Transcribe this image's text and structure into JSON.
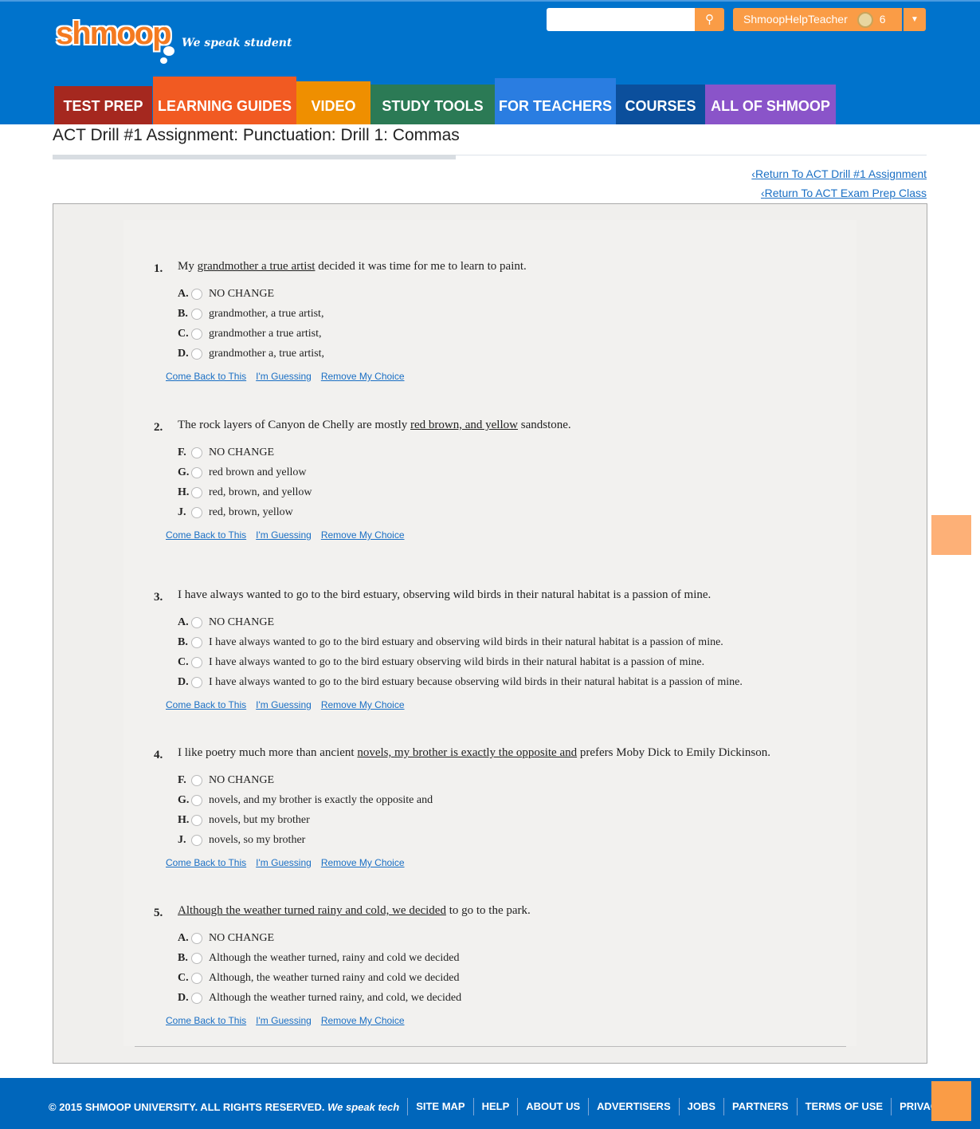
{
  "header": {
    "logo": "shmoop",
    "tagline": "We speak student",
    "search_placeholder": "",
    "search_icon": "search-icon",
    "username": "ShmoopHelpTeacher",
    "badge_count": "6",
    "dropdown_icon": "caret-down-icon"
  },
  "nav": [
    {
      "label": "TEST PREP",
      "color": "#a5281f"
    },
    {
      "label": "LEARNING GUIDES",
      "color": "#f15a22"
    },
    {
      "label": "VIDEO",
      "color": "#ef8f00"
    },
    {
      "label": "STUDY TOOLS",
      "color": "#2b7a55"
    },
    {
      "label": "FOR TEACHERS",
      "color": "#2a7de1"
    },
    {
      "label": "COURSES",
      "color": "#0b4f9c"
    },
    {
      "label": "ALL OF SHMOOP",
      "color": "#8a54c9"
    }
  ],
  "page": {
    "title": "ACT Drill #1 Assignment: Punctuation: Drill 1: Commas",
    "return_assignment": "Return To ACT Drill #1 Assignment",
    "return_class": "Return To ACT Exam Prep Class"
  },
  "actions": {
    "come_back": "Come Back to This",
    "guessing": "I'm Guessing",
    "remove": "Remove My Choice"
  },
  "questions": [
    {
      "num": "1.",
      "before": "My ",
      "underlined": "grandmother a true artist",
      "after": " decided it was time for me to learn to paint.",
      "options": [
        {
          "letter": "A.",
          "text": "NO CHANGE"
        },
        {
          "letter": "B.",
          "text": "grandmother, a true artist,"
        },
        {
          "letter": "C.",
          "text": "grandmother a true artist,"
        },
        {
          "letter": "D.",
          "text": "grandmother a, true artist,"
        }
      ]
    },
    {
      "num": "2.",
      "before": "The rock layers of Canyon de Chelly are mostly ",
      "underlined": "red brown, and yellow",
      "after": " sandstone.",
      "options": [
        {
          "letter": "F.",
          "text": "NO CHANGE"
        },
        {
          "letter": "G.",
          "text": "red brown and yellow"
        },
        {
          "letter": "H.",
          "text": "red, brown, and yellow"
        },
        {
          "letter": "J.",
          "text": "red, brown, yellow"
        }
      ]
    },
    {
      "num": "3.",
      "before": "I have always wanted to go to the bird estuary, observing wild birds in their natural habitat is a passion of mine.",
      "underlined": "",
      "after": "",
      "options": [
        {
          "letter": "A.",
          "text": "NO CHANGE"
        },
        {
          "letter": "B.",
          "text": "I have always wanted to go to the bird estuary and observing wild birds in their natural habitat is a passion of mine."
        },
        {
          "letter": "C.",
          "text": "I have always wanted to go to the bird estuary observing wild birds in their natural habitat is a passion of mine."
        },
        {
          "letter": "D.",
          "text": "I have always wanted to go to the bird estuary because observing wild birds in their natural habitat is a passion of mine."
        }
      ]
    },
    {
      "num": "4.",
      "before": "I like poetry much more than ancient ",
      "underlined": "novels, my brother is exactly the opposite and",
      "after": " prefers Moby Dick to Emily Dickinson.",
      "options": [
        {
          "letter": "F.",
          "text": "NO CHANGE"
        },
        {
          "letter": "G.",
          "text": "novels, and my brother is exactly the opposite and"
        },
        {
          "letter": "H.",
          "text": "novels, but my brother"
        },
        {
          "letter": "J.",
          "text": "novels, so my brother"
        }
      ]
    },
    {
      "num": "5.",
      "before": "",
      "underlined": "Although the weather turned rainy and cold, we decided",
      "after": " to go to the park.",
      "options": [
        {
          "letter": "A.",
          "text": "NO CHANGE"
        },
        {
          "letter": "B.",
          "text": "Although the weather turned, rainy and cold we decided"
        },
        {
          "letter": "C.",
          "text": "Although, the weather turned rainy and cold we decided"
        },
        {
          "letter": "D.",
          "text": "Although the weather turned rainy, and cold, we decided"
        }
      ]
    }
  ],
  "footer": {
    "copyright": "© 2015 SHMOOP UNIVERSITY. ALL RIGHTS RESERVED.",
    "tagline": "We speak tech",
    "links": [
      "SITE MAP",
      "HELP",
      "ABOUT US",
      "ADVERTISERS",
      "JOBS",
      "PARTNERS",
      "TERMS OF USE",
      "PRIVACY"
    ]
  }
}
